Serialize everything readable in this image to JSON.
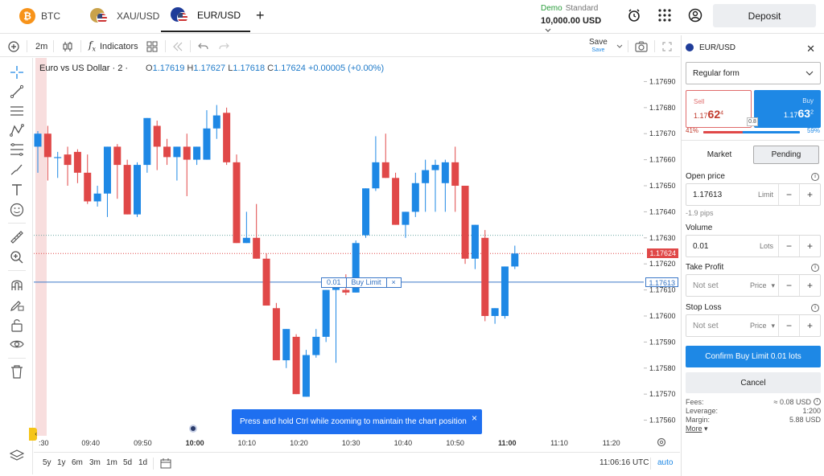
{
  "tabs": [
    {
      "label": "BTC",
      "icon": "bitcoin-icon"
    },
    {
      "label": "XAU/USD",
      "icon": "xau-usd-flag-icon"
    },
    {
      "label": "EUR/USD",
      "icon": "eur-usd-flag-icon"
    }
  ],
  "account": {
    "mode": "Demo",
    "type": "Standard",
    "balance": "10,000.00 USD"
  },
  "deposit_label": "Deposit",
  "toolbar": {
    "interval": "2m",
    "indicators": "Indicators",
    "save": "Save",
    "save_sub": "Save"
  },
  "chart_legend": {
    "title": "Euro vs US Dollar · 2 ·",
    "o_label": "O",
    "o": "1.17619",
    "h_label": "H",
    "h": "1.17627",
    "l_label": "L",
    "l": "1.17618",
    "c_label": "C",
    "c": "1.17624",
    "change": "+0.00005 (+0.00%)"
  },
  "colors": {
    "up": "#1e88e5",
    "down": "#e04848",
    "accent": "#1e6ff0",
    "sell": "#c0392b"
  },
  "chart_data": {
    "type": "candlestick",
    "symbol": "EUR/USD",
    "y_ticks": [
      "1.17690",
      "1.17680",
      "1.17670",
      "1.17660",
      "1.17650",
      "1.17640",
      "1.17630",
      "1.17620",
      "1.17610",
      "1.17600",
      "1.17590",
      "1.17580",
      "1.17570",
      "1.17560"
    ],
    "x_ticks": [
      ":30",
      "09:40",
      "09:50",
      "10:00",
      "10:10",
      "10:20",
      "10:30",
      "10:40",
      "10:50",
      "11:00",
      "11:10",
      "11:20"
    ],
    "ylim": [
      1.17554,
      1.17696
    ],
    "candles": [
      {
        "o": 1.17665,
        "h": 1.17671,
        "l": 1.17655,
        "c": 1.1767
      },
      {
        "o": 1.1767,
        "h": 1.17673,
        "l": 1.17652,
        "c": 1.17661
      },
      {
        "o": 1.17661,
        "h": 1.17663,
        "l": 1.17653,
        "c": 1.17661
      },
      {
        "o": 1.17662,
        "h": 1.17665,
        "l": 1.1765,
        "c": 1.17658
      },
      {
        "o": 1.17663,
        "h": 1.17664,
        "l": 1.17651,
        "c": 1.17655
      },
      {
        "o": 1.17655,
        "h": 1.17662,
        "l": 1.17643,
        "c": 1.17644
      },
      {
        "o": 1.17644,
        "h": 1.1765,
        "l": 1.17642,
        "c": 1.17647
      },
      {
        "o": 1.17647,
        "h": 1.17665,
        "l": 1.17638,
        "c": 1.17665
      },
      {
        "o": 1.17665,
        "h": 1.17666,
        "l": 1.17645,
        "c": 1.17658
      },
      {
        "o": 1.17658,
        "h": 1.1766,
        "l": 1.1764,
        "c": 1.17639
      },
      {
        "o": 1.17639,
        "h": 1.17659,
        "l": 1.17638,
        "c": 1.17658
      },
      {
        "o": 1.17658,
        "h": 1.17675,
        "l": 1.17655,
        "c": 1.17676
      },
      {
        "o": 1.17673,
        "h": 1.17675,
        "l": 1.17656,
        "c": 1.17665
      },
      {
        "o": 1.17665,
        "h": 1.17668,
        "l": 1.17658,
        "c": 1.17661
      },
      {
        "o": 1.17661,
        "h": 1.17663,
        "l": 1.17652,
        "c": 1.17665
      },
      {
        "o": 1.17665,
        "h": 1.1767,
        "l": 1.17646,
        "c": 1.1766
      },
      {
        "o": 1.1766,
        "h": 1.17665,
        "l": 1.17658,
        "c": 1.17665
      },
      {
        "o": 1.1766,
        "h": 1.17679,
        "l": 1.1766,
        "c": 1.17672
      },
      {
        "o": 1.17672,
        "h": 1.17681,
        "l": 1.17668,
        "c": 1.17677
      },
      {
        "o": 1.17678,
        "h": 1.1768,
        "l": 1.17658,
        "c": 1.17659
      },
      {
        "o": 1.17659,
        "h": 1.17662,
        "l": 1.17628,
        "c": 1.17628
      },
      {
        "o": 1.17628,
        "h": 1.1764,
        "l": 1.17628,
        "c": 1.1763
      },
      {
        "o": 1.1763,
        "h": 1.17643,
        "l": 1.17622,
        "c": 1.17622
      },
      {
        "o": 1.17622,
        "h": 1.17624,
        "l": 1.17604,
        "c": 1.17604
      },
      {
        "o": 1.17603,
        "h": 1.17605,
        "l": 1.17583,
        "c": 1.17583
      },
      {
        "o": 1.17583,
        "h": 1.17595,
        "l": 1.1758,
        "c": 1.17595
      },
      {
        "o": 1.17592,
        "h": 1.17593,
        "l": 1.1757,
        "c": 1.1757
      },
      {
        "o": 1.17569,
        "h": 1.17587,
        "l": 1.17569,
        "c": 1.17585
      },
      {
        "o": 1.17585,
        "h": 1.17595,
        "l": 1.17584,
        "c": 1.17592
      },
      {
        "o": 1.17592,
        "h": 1.176,
        "l": 1.1759,
        "c": 1.1761
      },
      {
        "o": 1.1761,
        "h": 1.17612,
        "l": 1.17582,
        "c": 1.17612
      },
      {
        "o": 1.1761,
        "h": 1.17616,
        "l": 1.17608,
        "c": 1.17609
      },
      {
        "o": 1.17609,
        "h": 1.17629,
        "l": 1.17609,
        "c": 1.17628
      },
      {
        "o": 1.17631,
        "h": 1.17649,
        "l": 1.1763,
        "c": 1.17649
      },
      {
        "o": 1.17649,
        "h": 1.17669,
        "l": 1.17648,
        "c": 1.17659
      },
      {
        "o": 1.17659,
        "h": 1.1767,
        "l": 1.17654,
        "c": 1.17653
      },
      {
        "o": 1.17653,
        "h": 1.17655,
        "l": 1.17635,
        "c": 1.17635
      },
      {
        "o": 1.17635,
        "h": 1.1764,
        "l": 1.1763,
        "c": 1.1764
      },
      {
        "o": 1.1764,
        "h": 1.17655,
        "l": 1.17638,
        "c": 1.17651
      },
      {
        "o": 1.17651,
        "h": 1.1766,
        "l": 1.1764,
        "c": 1.17656
      },
      {
        "o": 1.17656,
        "h": 1.1766,
        "l": 1.1764,
        "c": 1.17658
      },
      {
        "o": 1.17651,
        "h": 1.1766,
        "l": 1.1764,
        "c": 1.17659
      },
      {
        "o": 1.17659,
        "h": 1.17665,
        "l": 1.1764,
        "c": 1.1765
      },
      {
        "o": 1.1765,
        "h": 1.17645,
        "l": 1.1762,
        "c": 1.17622
      },
      {
        "o": 1.17622,
        "h": 1.17635,
        "l": 1.17618,
        "c": 1.17635
      },
      {
        "o": 1.1763,
        "h": 1.17633,
        "l": 1.17598,
        "c": 1.176
      },
      {
        "o": 1.176,
        "h": 1.17603,
        "l": 1.17597,
        "c": 1.17603
      },
      {
        "o": 1.176,
        "h": 1.17617,
        "l": 1.17599,
        "c": 1.17619
      },
      {
        "o": 1.17619,
        "h": 1.17627,
        "l": 1.17618,
        "c": 1.17624
      }
    ],
    "current_price": "1.17624",
    "order_price": "1.17613",
    "dotted_level": 1.17631
  },
  "order_line": {
    "volume": "0.01",
    "label": "Buy Limit",
    "close": "×"
  },
  "toast": {
    "text": "Press and hold Ctrl while zooming to maintain the chart position",
    "close": "×"
  },
  "timeframes": [
    "5y",
    "1y",
    "6m",
    "3m",
    "1m",
    "5d",
    "1d"
  ],
  "clock": "11:06:16 UTC",
  "auto": "auto",
  "panel": {
    "symbol": "EUR/USD",
    "form": "Regular form",
    "sell": {
      "label": "Sell",
      "prefix": "1.17",
      "big": "62",
      "sup": "4"
    },
    "buy": {
      "label": "Buy",
      "prefix": "1.17",
      "big": "63",
      "sup": "2"
    },
    "spread": "0.8",
    "sell_pct": "41%",
    "buy_pct": "59%",
    "sell_fraction": 0.41,
    "mode_tabs": [
      "Market",
      "Pending"
    ],
    "open_price_label": "Open price",
    "open_price": "1.17613",
    "open_price_type": "Limit",
    "pips": "-1.9 pips",
    "volume_label": "Volume",
    "volume": "0.01",
    "volume_unit": "Lots",
    "tp_label": "Take Profit",
    "tp_value": "Not set",
    "tp_unit": "Price",
    "sl_label": "Stop Loss",
    "sl_value": "Not set",
    "sl_unit": "Price",
    "confirm": "Confirm Buy Limit 0.01 lots",
    "cancel": "Cancel",
    "fees_label": "Fees:",
    "fees": "≈ 0.08 USD",
    "leverage_label": "Leverage:",
    "leverage": "1:200",
    "margin_label": "Margin:",
    "margin": "5.88 USD",
    "more": "More"
  }
}
